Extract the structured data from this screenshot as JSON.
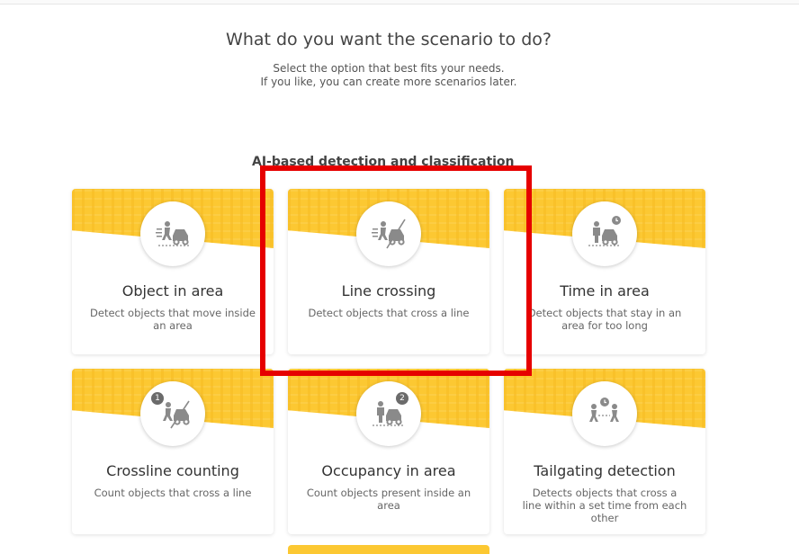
{
  "page": {
    "title": "What do you want the scenario to do?",
    "subtitle_line1": "Select the option that best fits your needs.",
    "subtitle_line2": "If you like, you can create more scenarios later.",
    "section_heading": "AI-based detection and classification"
  },
  "cards": [
    {
      "title": "Object in area",
      "desc": "Detect objects that move inside an area",
      "icon": "person-car-area-icon"
    },
    {
      "title": "Line crossing",
      "desc": "Detect objects that cross a line",
      "icon": "person-car-line-icon"
    },
    {
      "title": "Time in area",
      "desc": "Detect objects that stay in an area for too long",
      "icon": "person-car-clock-icon"
    },
    {
      "title": "Crossline counting",
      "desc": "Count objects that cross a line",
      "icon": "crossline-count-icon",
      "badge": "1"
    },
    {
      "title": "Occupancy in area",
      "desc": "Count objects present inside an area",
      "icon": "occupancy-icon",
      "badge": "2"
    },
    {
      "title": "Tailgating detection",
      "desc": "Detects objects that cross a line within a set time from each other",
      "icon": "tailgating-icon"
    }
  ],
  "colors": {
    "banner": "#fcc832",
    "highlight": "#e60000",
    "icon": "#8a8a8a"
  }
}
